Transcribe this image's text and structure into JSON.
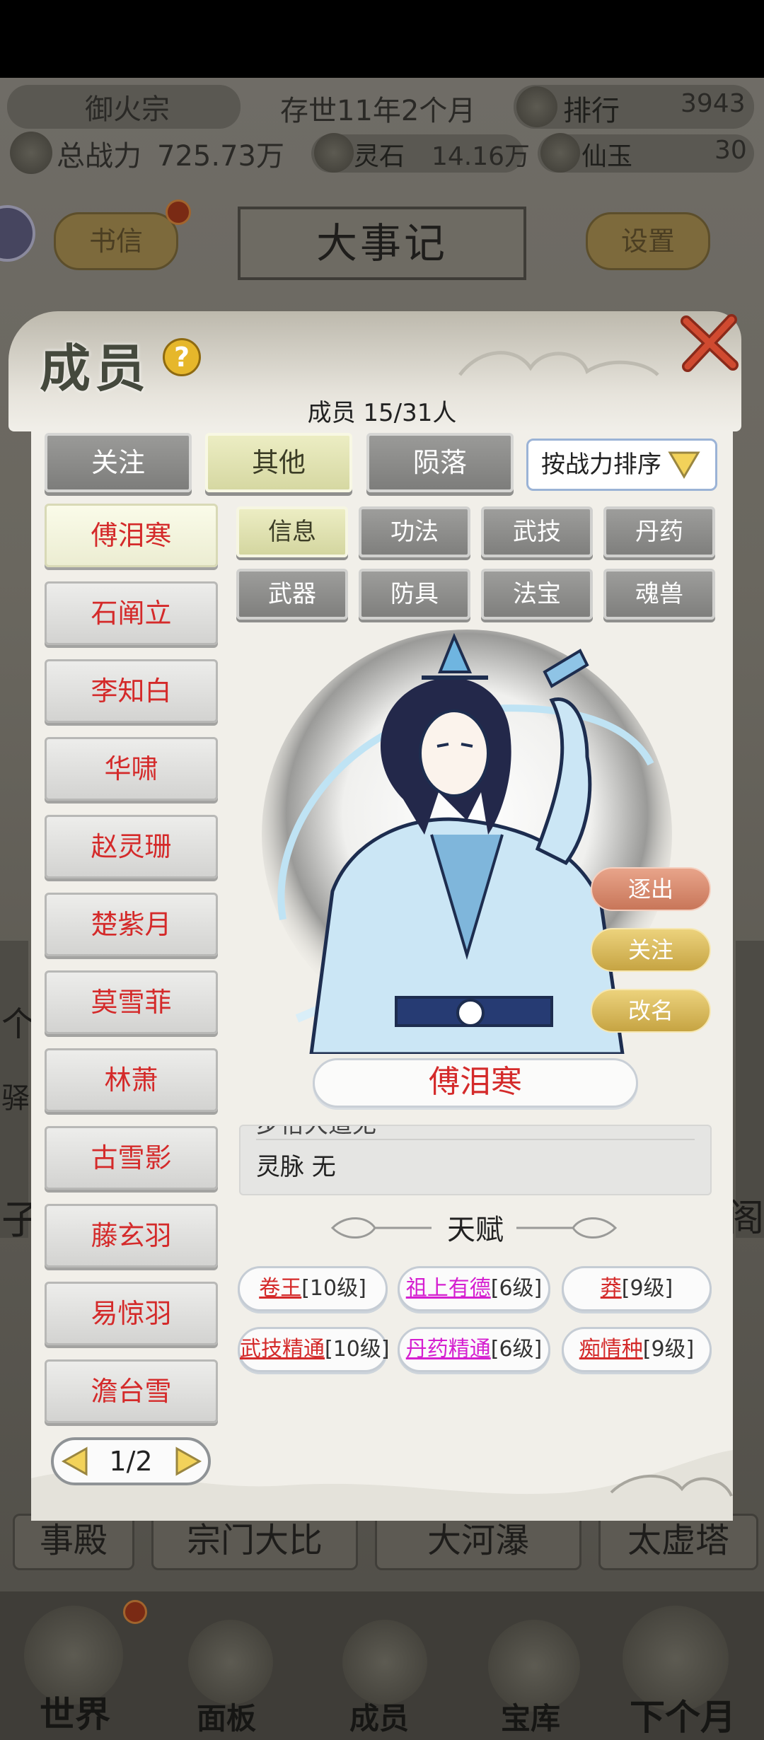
{
  "top_bar": {
    "sect_name": "御火宗",
    "age": "存世11年2个月",
    "rank_label": "排行",
    "rank_value": "3943",
    "power_label": "总战力",
    "power_value": "725.73万",
    "spirit_stone_label": "灵石",
    "spirit_stone_value": "14.16万",
    "jade_label": "仙玉",
    "jade_value": "30"
  },
  "bg_buttons": {
    "letters": "书信",
    "chronicle": "大事记",
    "settings": "设置"
  },
  "bg_strip": {
    "item1": "事殿",
    "item2": "宗门大比",
    "item3": "大河瀑",
    "item4": "太虚塔"
  },
  "bg_side_text": {
    "left_a": "个",
    "left_b": "驿",
    "left_c": "子",
    "right_a": "阁"
  },
  "bottom_nav": {
    "world": "世界",
    "panel": "面板",
    "members": "成员",
    "treasury": "宝库",
    "next_month": "下个月"
  },
  "panel": {
    "title": "成员",
    "help": "?",
    "member_count": "成员  15/31人",
    "tabs": {
      "follow": "关注",
      "other": "其他",
      "fallen": "陨落"
    },
    "sort_label": "按战力排序"
  },
  "members": [
    "傅泪寒",
    "石阐立",
    "李知白",
    "华啸",
    "赵灵珊",
    "楚紫月",
    "莫雪菲",
    "林萧",
    "古雪影",
    "藤玄羽",
    "易惊羽",
    "澹台雪"
  ],
  "sub_tabs": {
    "info": "信息",
    "technique": "功法",
    "martial": "武技",
    "pill": "丹药",
    "weapon": "武器",
    "armor": "防具",
    "artifact": "法宝",
    "beast": "魂兽"
  },
  "character": {
    "name": "傅泪寒",
    "expel": "逐出",
    "follow": "关注",
    "rename": "改名",
    "info_cut_text": "步怡大道无",
    "lingmai": "灵脉 无"
  },
  "talents": {
    "title": "天赋",
    "items": [
      {
        "name": "卷王",
        "level": "[10级]"
      },
      {
        "name": "祖上有德",
        "level": "[6级]"
      },
      {
        "name": "莽",
        "level": "[9级]"
      },
      {
        "name": "武技精通",
        "level": "[10级]"
      },
      {
        "name": "丹药精通",
        "level": "[6级]"
      },
      {
        "name": "痴情种",
        "level": "[9级]"
      }
    ]
  },
  "pager": {
    "text": "1/2"
  },
  "colors": {
    "member_name": "#d42a2a",
    "talent_pink": "#d51fd0",
    "active_tab": "#d6d8a2"
  }
}
